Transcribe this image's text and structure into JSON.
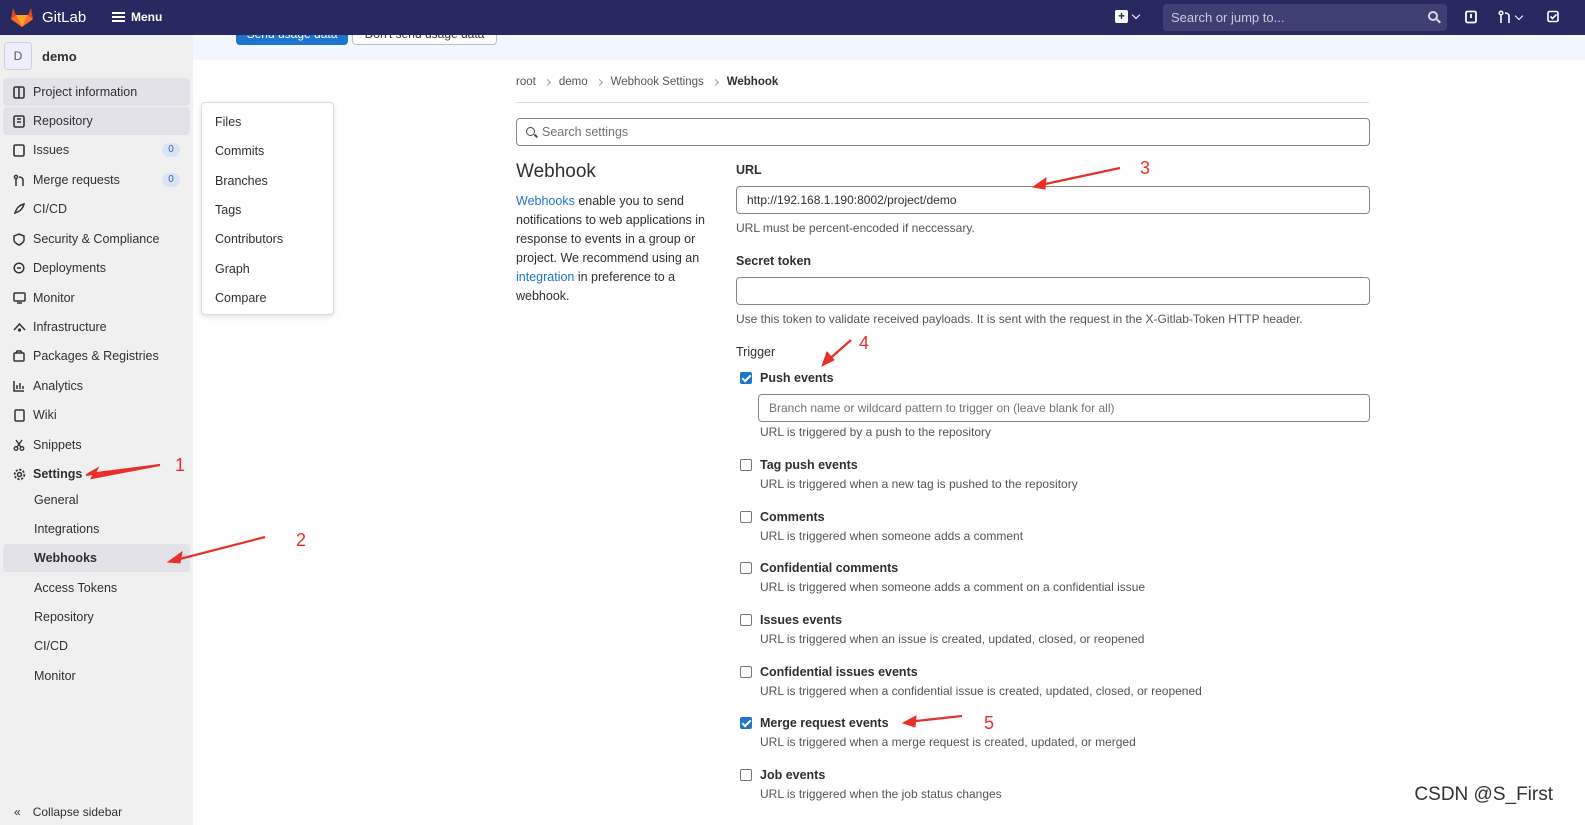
{
  "topbar": {
    "brand": "GitLab",
    "menu_label": "Menu",
    "search_placeholder": "Search or jump to..."
  },
  "sidebar": {
    "project_initial": "D",
    "project_name": "demo",
    "items": [
      {
        "label": "Project information",
        "icon": "info-icon"
      },
      {
        "label": "Repository",
        "icon": "repository-icon"
      },
      {
        "label": "Issues",
        "icon": "issues-icon",
        "badge": "0"
      },
      {
        "label": "Merge requests",
        "icon": "merge-request-icon",
        "badge": "0"
      },
      {
        "label": "CI/CD",
        "icon": "rocket-icon"
      },
      {
        "label": "Security & Compliance",
        "icon": "shield-icon"
      },
      {
        "label": "Deployments",
        "icon": "deployments-icon"
      },
      {
        "label": "Monitor",
        "icon": "monitor-icon"
      },
      {
        "label": "Infrastructure",
        "icon": "cloud-icon"
      },
      {
        "label": "Packages & Registries",
        "icon": "package-icon"
      },
      {
        "label": "Analytics",
        "icon": "chart-icon"
      },
      {
        "label": "Wiki",
        "icon": "book-icon"
      },
      {
        "label": "Snippets",
        "icon": "scissors-icon"
      },
      {
        "label": "Settings",
        "icon": "gear-icon"
      }
    ],
    "settings_sub": [
      "General",
      "Integrations",
      "Webhooks",
      "Access Tokens",
      "Repository",
      "CI/CD",
      "Monitor"
    ],
    "collapse_label": "Collapse sidebar"
  },
  "flyout": [
    "Files",
    "Commits",
    "Branches",
    "Tags",
    "Contributors",
    "Graph",
    "Compare"
  ],
  "banner": {
    "send_label": "Send usage data",
    "dont_label": "Don't send usage data"
  },
  "breadcrumb": [
    "root",
    "demo",
    "Webhook Settings",
    "Webhook"
  ],
  "search_settings_placeholder": "Search settings",
  "webhook": {
    "title": "Webhook",
    "desc_link1": "Webhooks",
    "desc_part1": " enable you to send notifications to web applications in response to events in a group or project. We recommend using an ",
    "desc_link2": "integration",
    "desc_part2": " in preference to a webhook."
  },
  "form": {
    "url_label": "URL",
    "url_value": "http://192.168.1.190:8002/project/demo",
    "url_help": "URL must be percent-encoded if neccessary.",
    "token_label": "Secret token",
    "token_value": "",
    "token_help": "Use this token to validate received payloads. It is sent with the request in the X-Gitlab-Token HTTP header.",
    "trigger_label": "Trigger",
    "branch_placeholder": "Branch name or wildcard pattern to trigger on (leave blank for all)",
    "triggers": [
      {
        "label": "Push events",
        "checked": true,
        "help": "URL is triggered by a push to the repository"
      },
      {
        "label": "Tag push events",
        "checked": false,
        "help": "URL is triggered when a new tag is pushed to the repository"
      },
      {
        "label": "Comments",
        "checked": false,
        "help": "URL is triggered when someone adds a comment"
      },
      {
        "label": "Confidential comments",
        "checked": false,
        "help": "URL is triggered when someone adds a comment on a confidential issue"
      },
      {
        "label": "Issues events",
        "checked": false,
        "help": "URL is triggered when an issue is created, updated, closed, or reopened"
      },
      {
        "label": "Confidential issues events",
        "checked": false,
        "help": "URL is triggered when a confidential issue is created, updated, closed, or reopened"
      },
      {
        "label": "Merge request events",
        "checked": true,
        "help": "URL is triggered when a merge request is created, updated, or merged"
      },
      {
        "label": "Job events",
        "checked": false,
        "help": "URL is triggered when the job status changes"
      }
    ]
  },
  "annotations": [
    "1",
    "2",
    "3",
    "4",
    "5"
  ],
  "annotation_color": "#e8302a",
  "watermark": "CSDN @S_First"
}
